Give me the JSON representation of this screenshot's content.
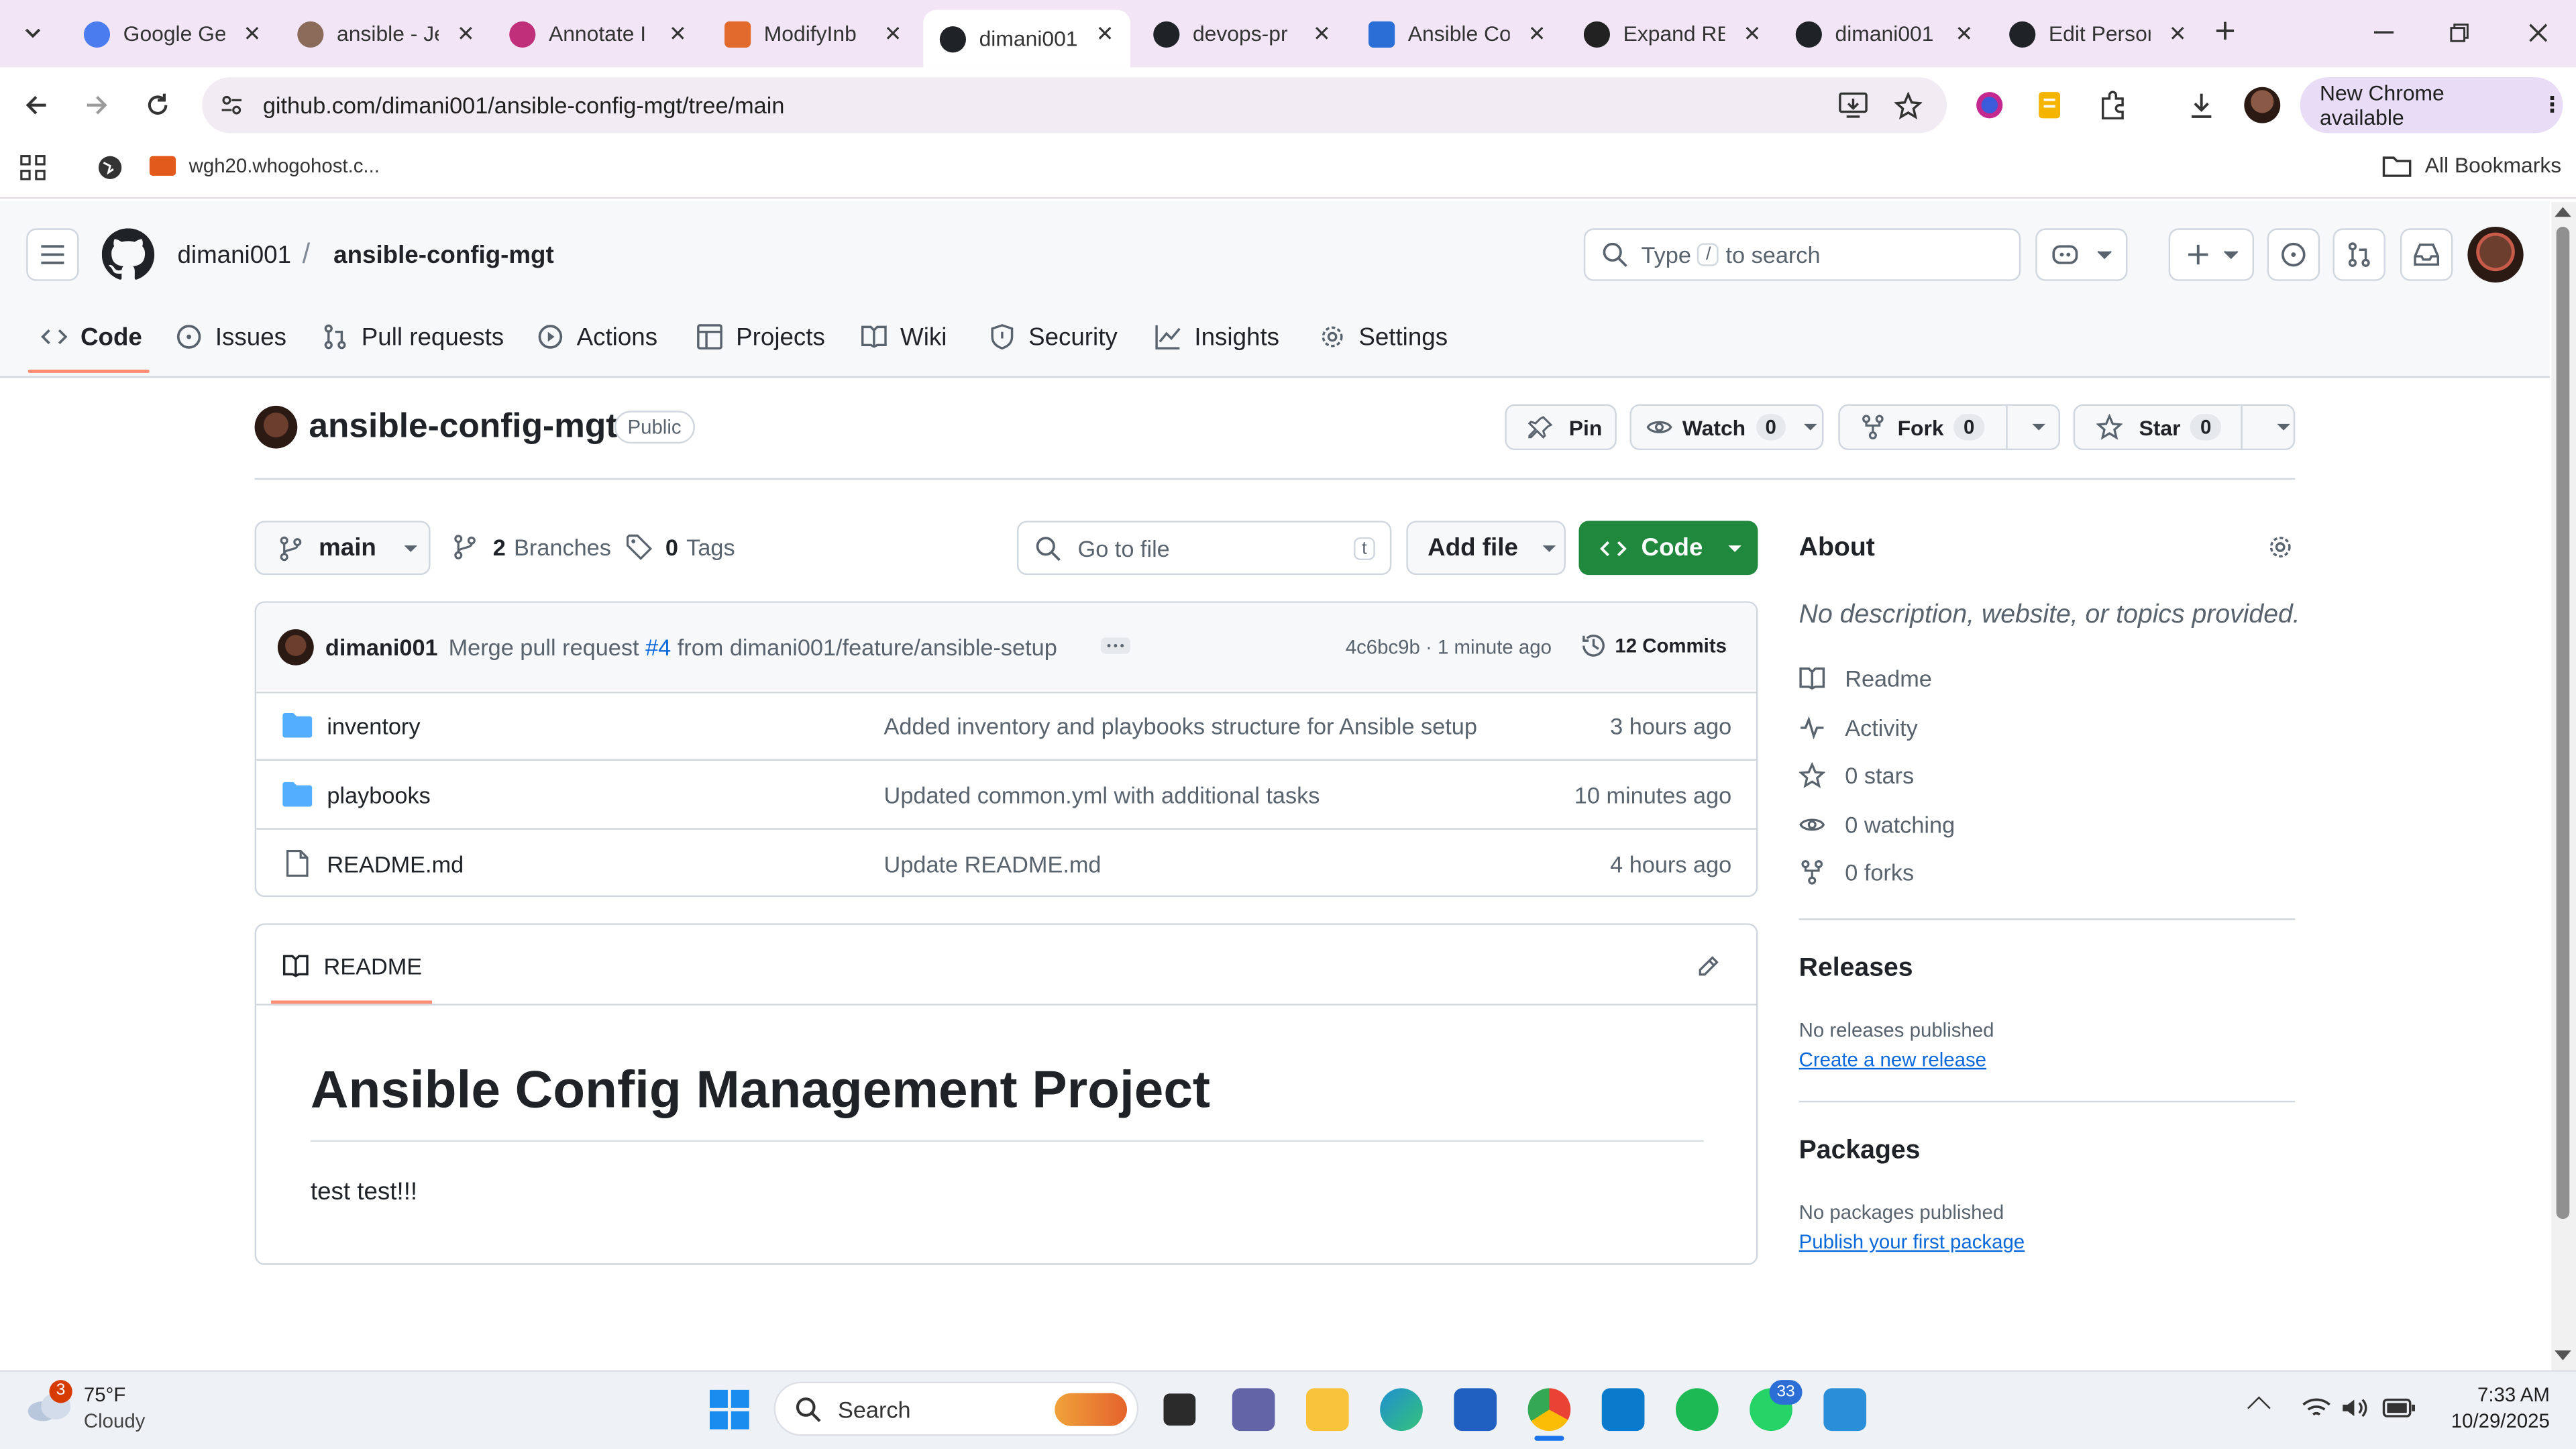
{
  "browser": {
    "tabs": [
      {
        "title": "Google Ge",
        "color": "#4a7cf0",
        "active": false
      },
      {
        "title": "ansible - Je",
        "color": "#8a6a58",
        "active": false
      },
      {
        "title": "Annotate I",
        "color": "#c0307a",
        "active": false
      },
      {
        "title": "ModifyInb",
        "color": "#e26a2c",
        "active": false
      },
      {
        "title": "dimani001",
        "color": "#1f2328",
        "active": true
      },
      {
        "title": "devops-pr",
        "color": "#1f2328",
        "active": false
      },
      {
        "title": "Ansible Co",
        "color": "#2a6fd6",
        "active": false
      },
      {
        "title": "Expand RE",
        "color": "#222",
        "active": false
      },
      {
        "title": "dimani001",
        "color": "#1f2328",
        "active": false
      },
      {
        "title": "Edit Persor",
        "color": "#1f2328",
        "active": false
      }
    ],
    "close_glyph": "✕",
    "new_tab_glyph": "+",
    "url": "github.com/dimani001/ansible-config-mgt/tree/main",
    "update_button": "New Chrome available",
    "bookmark": "wgh20.whogohost.c...",
    "all_bookmarks": "All Bookmarks"
  },
  "github": {
    "owner": "dimani001",
    "sep": "/",
    "repo": "ansible-config-mgt",
    "search_prefix": "Type",
    "search_key": "/",
    "search_suffix": "to search",
    "nav": [
      {
        "label": "Code",
        "icon": "code-icon"
      },
      {
        "label": "Issues",
        "icon": "issue-icon"
      },
      {
        "label": "Pull requests",
        "icon": "pr-icon"
      },
      {
        "label": "Actions",
        "icon": "play-icon"
      },
      {
        "label": "Projects",
        "icon": "table-icon"
      },
      {
        "label": "Wiki",
        "icon": "book-icon"
      },
      {
        "label": "Security",
        "icon": "shield-icon"
      },
      {
        "label": "Insights",
        "icon": "graph-icon"
      },
      {
        "label": "Settings",
        "icon": "gear-icon"
      }
    ],
    "visibility": "Public",
    "pin": "Pin",
    "watch": "Watch",
    "watch_count": "0",
    "fork": "Fork",
    "fork_count": "0",
    "star": "Star",
    "star_count": "0",
    "branch": "main",
    "branches_count": "2",
    "branches_label": "Branches",
    "tags_count": "0",
    "tags_label": "Tags",
    "goto_placeholder": "Go to file",
    "goto_key": "t",
    "add_file": "Add file",
    "code_button": "Code",
    "commit": {
      "author": "dimani001",
      "msg_pre": "Merge pull request",
      "pr": "#4",
      "msg_post": "from dimani001/feature/ansible-setup",
      "sha": "4c6bc9b",
      "dot": "·",
      "time": "1 minute ago",
      "commits": "12 Commits"
    },
    "files": [
      {
        "name": "inventory",
        "type": "dir",
        "message": "Added inventory and playbooks structure for Ansible setup",
        "age": "3 hours ago"
      },
      {
        "name": "playbooks",
        "type": "dir",
        "message": "Updated common.yml with additional tasks",
        "age": "10 minutes ago"
      },
      {
        "name": "README.md",
        "type": "file",
        "message": "Update README.md",
        "age": "4 hours ago"
      }
    ],
    "readme_tab": "README",
    "readme_title": "Ansible Config Management Project",
    "readme_body": "test test!!!",
    "about": {
      "title": "About",
      "desc": "No description, website, or topics provided.",
      "links": [
        {
          "label": "Readme",
          "icon": "book-icon"
        },
        {
          "label": "Activity",
          "icon": "pulse-icon"
        },
        {
          "label": "0 stars",
          "icon": "star-icon"
        },
        {
          "label": "0 watching",
          "icon": "eye-icon"
        },
        {
          "label": "0 forks",
          "icon": "fork-icon"
        }
      ]
    },
    "releases": {
      "title": "Releases",
      "none": "No releases published",
      "link": "Create a new release"
    },
    "packages": {
      "title": "Packages",
      "none": "No packages published",
      "link": "Publish your first package"
    }
  },
  "taskbar": {
    "weather_badge": "3",
    "temp": "75°F",
    "cond": "Cloudy",
    "search": "Search",
    "whatsapp_badge": "33",
    "time": "7:33 AM",
    "date": "10/29/2025"
  },
  "colors": {
    "accent": "#1f883d",
    "link": "#0969da",
    "folder": "#54aeff",
    "active_tab": "#fd8c73"
  }
}
